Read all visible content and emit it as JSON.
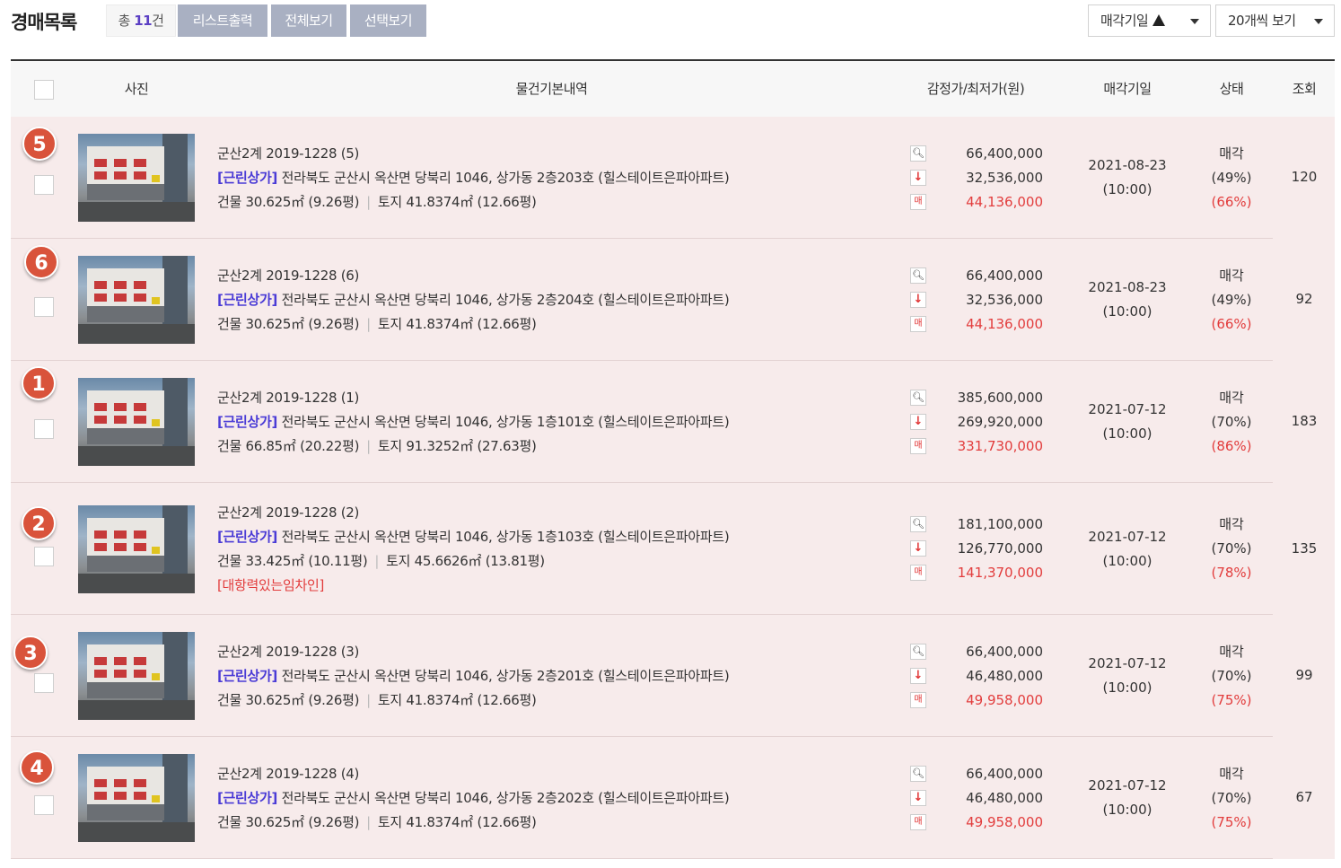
{
  "header": {
    "title": "경매목록",
    "count_prefix": "총 ",
    "count": "11",
    "count_suffix": "건",
    "buttons": [
      "리스트출력",
      "전체보기",
      "선택보기"
    ],
    "sort_label": "매각기일",
    "per_page_label": "20개씩 보기"
  },
  "columns": [
    "사진",
    "물건기본내역",
    "감정가/최저가(원)",
    "매각기일",
    "상태",
    "조회"
  ],
  "rows": [
    {
      "badge": "5",
      "case": "군산2계 2019-1228 (5)",
      "category": "[근린상가]",
      "address": "전라북도 군산시 옥산면 당북리 1046, 상가동 2층203호 (힐스테이트은파아파트)",
      "area": "건물 30.625㎡ (9.26평)",
      "land": "토지 41.8374㎡ (12.66평)",
      "note": "",
      "appraisal": "66,400,000",
      "minimum": "32,536,000",
      "sale": "44,136,000",
      "date": "2021-08-23",
      "time": "(10:00)",
      "state": "매각",
      "pct1": "(49%)",
      "pct2": "(66%)",
      "views": "120"
    },
    {
      "badge": "6",
      "case": "군산2계 2019-1228 (6)",
      "category": "[근린상가]",
      "address": "전라북도 군산시 옥산면 당북리 1046, 상가동 2층204호 (힐스테이트은파아파트)",
      "area": "건물 30.625㎡ (9.26평)",
      "land": "토지 41.8374㎡ (12.66평)",
      "note": "",
      "appraisal": "66,400,000",
      "minimum": "32,536,000",
      "sale": "44,136,000",
      "date": "2021-08-23",
      "time": "(10:00)",
      "state": "매각",
      "pct1": "(49%)",
      "pct2": "(66%)",
      "views": "92"
    },
    {
      "badge": "1",
      "case": "군산2계 2019-1228 (1)",
      "category": "[근린상가]",
      "address": "전라북도 군산시 옥산면 당북리 1046, 상가동 1층101호 (힐스테이트은파아파트)",
      "area": "건물 66.85㎡ (20.22평)",
      "land": "토지 91.3252㎡ (27.63평)",
      "note": "",
      "appraisal": "385,600,000",
      "minimum": "269,920,000",
      "sale": "331,730,000",
      "date": "2021-07-12",
      "time": "(10:00)",
      "state": "매각",
      "pct1": "(70%)",
      "pct2": "(86%)",
      "views": "183"
    },
    {
      "badge": "2",
      "case": "군산2계 2019-1228 (2)",
      "category": "[근린상가]",
      "address": "전라북도 군산시 옥산면 당북리 1046, 상가동 1층103호 (힐스테이트은파아파트)",
      "area": "건물 33.425㎡ (10.11평)",
      "land": "토지 45.6626㎡ (13.81평)",
      "note": "[대항력있는임차인]",
      "appraisal": "181,100,000",
      "minimum": "126,770,000",
      "sale": "141,370,000",
      "date": "2021-07-12",
      "time": "(10:00)",
      "state": "매각",
      "pct1": "(70%)",
      "pct2": "(78%)",
      "views": "135"
    },
    {
      "badge": "3",
      "case": "군산2계 2019-1228 (3)",
      "category": "[근린상가]",
      "address": "전라북도 군산시 옥산면 당북리 1046, 상가동 2층201호 (힐스테이트은파아파트)",
      "area": "건물 30.625㎡ (9.26평)",
      "land": "토지 41.8374㎡ (12.66평)",
      "note": "",
      "appraisal": "66,400,000",
      "minimum": "46,480,000",
      "sale": "49,958,000",
      "date": "2021-07-12",
      "time": "(10:00)",
      "state": "매각",
      "pct1": "(70%)",
      "pct2": "(75%)",
      "views": "99"
    },
    {
      "badge": "4",
      "case": "군산2계 2019-1228 (4)",
      "category": "[근린상가]",
      "address": "전라북도 군산시 옥산면 당북리 1046, 상가동 2층202호 (힐스테이트은파아파트)",
      "area": "건물 30.625㎡ (9.26평)",
      "land": "토지 41.8374㎡ (12.66평)",
      "note": "",
      "appraisal": "66,400,000",
      "minimum": "46,480,000",
      "sale": "49,958,000",
      "date": "2021-07-12",
      "time": "(10:00)",
      "state": "매각",
      "pct1": "(70%)",
      "pct2": "(75%)",
      "views": "67"
    }
  ],
  "icons": {
    "search": "magnifier-icon",
    "down": "down-arrow-icon",
    "sale": "매"
  },
  "colors": {
    "accent_purple": "#4a3bd6",
    "price_red": "#e23c3c",
    "row_bg": "#f7ebeb",
    "badge": "#d9533b",
    "button_gray": "#a9b0c2"
  }
}
